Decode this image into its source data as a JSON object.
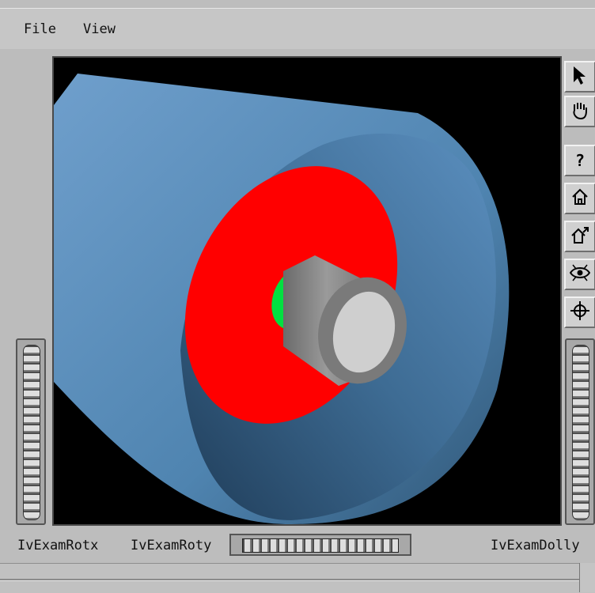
{
  "menu": {
    "file": "File",
    "view": "View"
  },
  "toolbar": {
    "select_icon": "arrow-pointer-icon",
    "pan_icon": "hand-icon",
    "help_label": "?",
    "home_icon": "home-icon",
    "set_home_icon": "set-home-icon",
    "view_all_icon": "eye-icon",
    "seek_icon": "crosshair-icon"
  },
  "wheels": {
    "rotx_label": "IvExamRotx",
    "roty_label": "IvExamRoty",
    "dolly_label": "IvExamDolly"
  },
  "colors": {
    "background": "#000000",
    "cone": "#5b8fbf",
    "disk": "#ff0000",
    "ring": "#00ff40",
    "cylinder": "#8a8a8a"
  }
}
